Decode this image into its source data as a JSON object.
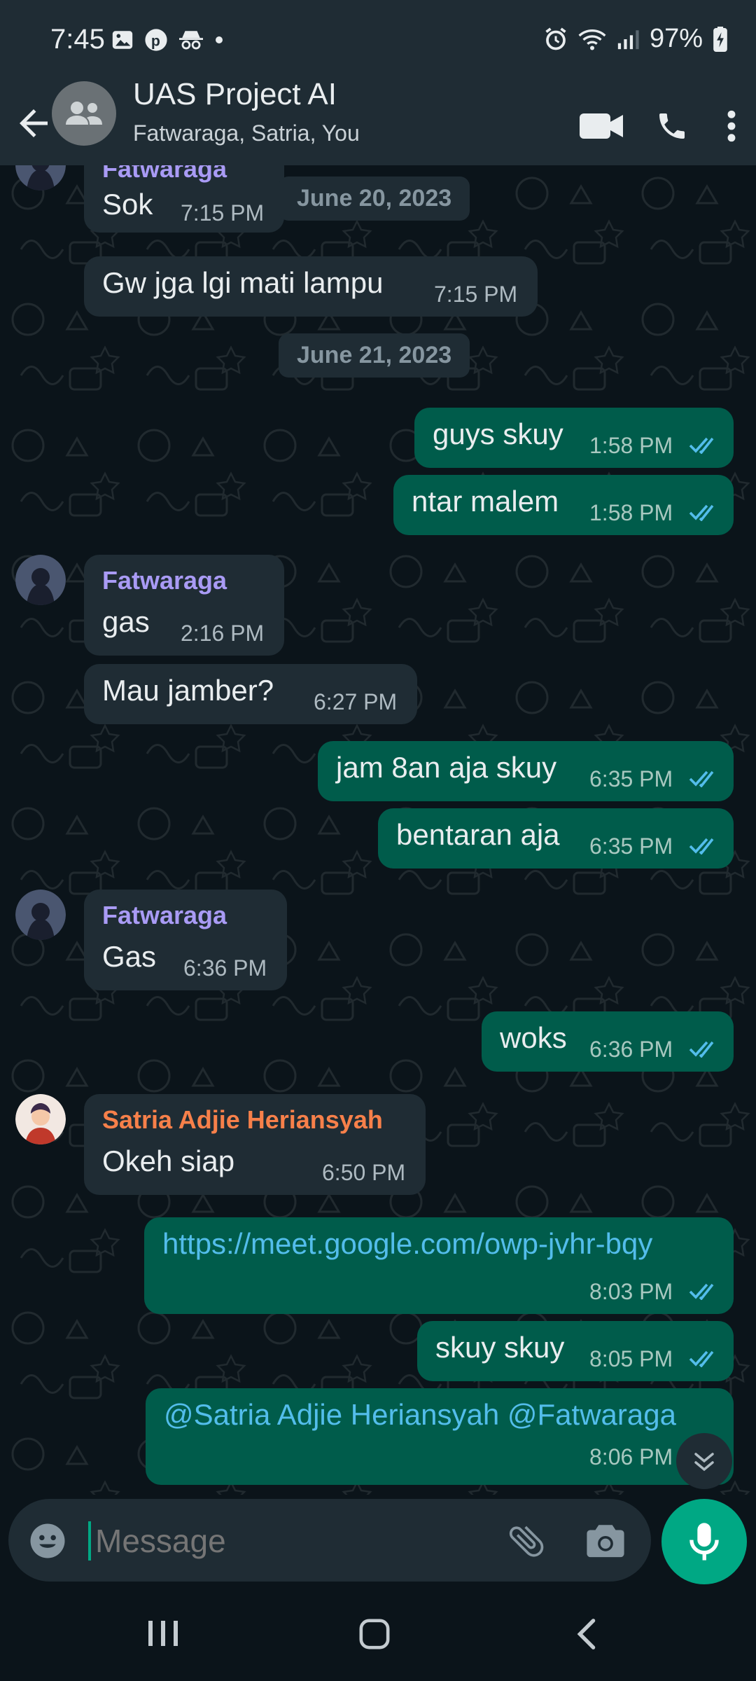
{
  "status_bar": {
    "time": "7:45",
    "battery": "97%"
  },
  "header": {
    "title": "UAS Project AI",
    "subtitle": "Fatwaraga, Satria, You"
  },
  "dates": [
    "June 20, 2023",
    "June 21, 2023"
  ],
  "messages": [
    {
      "sender": "Fatwaraga",
      "text": "Sok",
      "time": "7:15 PM"
    },
    {
      "text": "Gw jga lgi mati lampu",
      "time": "7:15 PM"
    },
    {
      "text": "guys skuy",
      "time": "1:58 PM"
    },
    {
      "text": "ntar malem",
      "time": "1:58 PM"
    },
    {
      "sender": "Fatwaraga",
      "text": "gas",
      "time": "2:16 PM"
    },
    {
      "text": "Mau jamber?",
      "time": "6:27 PM"
    },
    {
      "text": "jam 8an aja skuy",
      "time": "6:35 PM"
    },
    {
      "text": "bentaran aja",
      "time": "6:35 PM"
    },
    {
      "sender": "Fatwaraga",
      "text": "Gas",
      "time": "6:36 PM"
    },
    {
      "text": "woks",
      "time": "6:36 PM"
    },
    {
      "sender": "Satria Adjie Heriansyah",
      "text": "Okeh siap",
      "time": "6:50 PM"
    },
    {
      "text": "https://meet.google.com/owp-jvhr-bqy",
      "time": "8:03 PM"
    },
    {
      "text": "skuy skuy",
      "time": "8:05 PM"
    },
    {
      "text": "@Satria Adjie Heriansyah @Fatwaraga",
      "time": "8:06 PM"
    }
  ],
  "input": {
    "placeholder": "Message"
  },
  "colors": {
    "outgoing": "#005c4b",
    "incoming": "#1f2c34",
    "accent": "#00a884",
    "link": "#53bdeb",
    "sender_fatwaraga": "#a99bf5",
    "sender_satria": "#f7804a"
  },
  "icons": [
    "back-arrow-icon",
    "group-icon",
    "video-call-icon",
    "phone-icon",
    "more-vert-icon",
    "emoji-icon",
    "attach-icon",
    "camera-icon",
    "mic-icon",
    "double-check-icon",
    "chevron-down-icon"
  ]
}
